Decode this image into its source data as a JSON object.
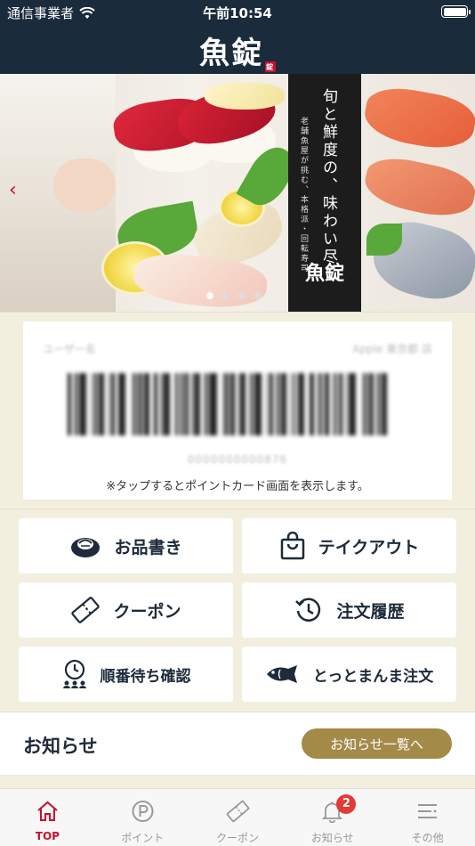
{
  "status_bar": {
    "carrier": "通信事業者",
    "time": "午前10:54"
  },
  "header": {
    "logo_text": "魚錠",
    "logo_mark": "錠"
  },
  "banner": {
    "headline": "旬と鮮度の、味わい尽し",
    "subline": "老舗魚屋が挑む、本格派・回転寿司",
    "brand_small": "魚錠",
    "slides_count": 4,
    "active_slide": 1
  },
  "member_card": {
    "user_label": "ユーザー名",
    "store_label": "Apple 東京都 店",
    "card_number": "0000000000876",
    "note": "※タップするとポイントカード画面を表示します。"
  },
  "menu": {
    "menu_book": "お品書き",
    "takeout": "テイクアウト",
    "coupon": "クーポン",
    "order_history": "注文履歴",
    "queue_check": "順番待ち確認",
    "tottomanma_order": "とっとまんま注文"
  },
  "news": {
    "title": "お知らせ",
    "list_button": "お知らせ一覧へ"
  },
  "tabbar": {
    "top": "TOP",
    "point": "ポイント",
    "coupon": "クーポン",
    "notice": "お知らせ",
    "notice_badge": "2",
    "other": "その他"
  },
  "colors": {
    "header_bg": "#1a2b3c",
    "accent_red": "#c8102e",
    "gold_button": "#a48a48",
    "page_bg": "#f2efdf"
  }
}
